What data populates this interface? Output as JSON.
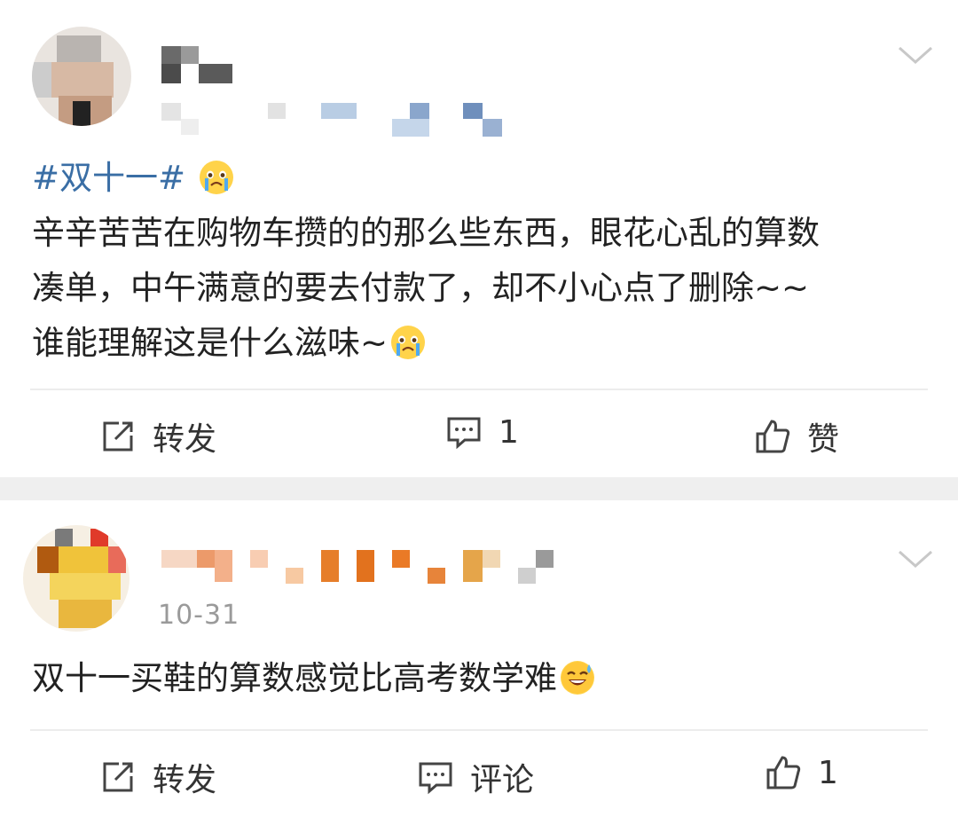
{
  "posts": [
    {
      "hashtag": "#双十一#",
      "content_lines": [
        "辛辛苦苦在购物车攒的的那么些东西，眼花心乱的算数",
        "凑单，中午满意的要去付款了，却不小心点了删除~~",
        "谁能理解这是什么滋味~"
      ],
      "emoji": "crying-emoji",
      "actions": {
        "repost_label": "转发",
        "comment_count": "1",
        "like_label": "赞"
      }
    },
    {
      "timestamp": "10-31",
      "content_line": "双十一买鞋的算数感觉比高考数学难",
      "emoji": "sweat-smile-emoji",
      "actions": {
        "repost_label": "转发",
        "comment_label": "评论",
        "like_count": "1"
      }
    }
  ],
  "colors": {
    "hashtag": "#3a6ea5",
    "separator": "#efefef",
    "timestamp": "#9a9a9a"
  }
}
